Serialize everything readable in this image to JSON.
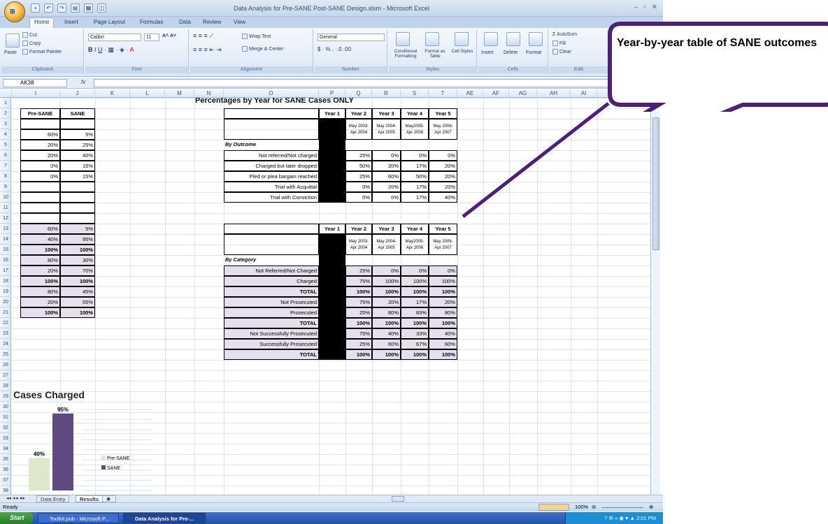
{
  "window": {
    "title": "Data Analysis for Pre-SANE Post-SANE Design.xlsm - Microsoft Excel",
    "office_button": "Office",
    "controls": [
      "–",
      "▫",
      "✕"
    ]
  },
  "ribbon": {
    "tabs": [
      "Home",
      "Insert",
      "Page Layout",
      "Formulas",
      "Data",
      "Review",
      "View"
    ],
    "clipboard": {
      "paste": "Paste",
      "cut": "Cut",
      "copy": "Copy",
      "format_painter": "Format Painter",
      "label": "Clipboard"
    },
    "font": {
      "name": "Calibri",
      "size": "11",
      "label": "Font"
    },
    "alignment": {
      "wrap": "Wrap Text",
      "merge": "Merge & Center",
      "label": "Alignment"
    },
    "number": {
      "format": "General",
      "label": "Number"
    },
    "styles": {
      "conditional": "Conditional Formatting",
      "table": "Format as Table",
      "cell": "Cell Styles",
      "label": "Styles"
    },
    "cells": {
      "insert": "Insert",
      "delete": "Delete",
      "format": "Format",
      "label": "Cells"
    },
    "editing": {
      "autosum": "AutoSum",
      "fill": "Fill",
      "clear": "Clear",
      "label": "Editi"
    }
  },
  "formula_bar": {
    "name_box": "AK38",
    "fx": "fx",
    "value": ""
  },
  "columns": [
    "I",
    "J",
    "K",
    "L",
    "M",
    "N",
    "O",
    "P",
    "Q",
    "R",
    "S",
    "T",
    "AE",
    "AF",
    "AG",
    "AH",
    "AI"
  ],
  "rows": [
    "1",
    "2",
    "3",
    "4",
    "5",
    "6",
    "7",
    "8",
    "9",
    "10",
    "11",
    "12",
    "13",
    "14",
    "15",
    "16",
    "17",
    "18",
    "19",
    "20",
    "21",
    "22",
    "23",
    "24",
    "25",
    "26",
    "27",
    "28",
    "29",
    "30",
    "31",
    "32",
    "33",
    "34",
    "35",
    "36",
    "37",
    "38"
  ],
  "left_table": {
    "headers": [
      "Pre-SANE",
      "SANE"
    ],
    "rows": [
      [
        "",
        ""
      ],
      [
        "60%",
        "5%"
      ],
      [
        "20%",
        "25%"
      ],
      [
        "20%",
        "40%"
      ],
      [
        "0%",
        "15%"
      ],
      [
        "0%",
        "15%"
      ],
      [
        "",
        ""
      ],
      [
        "",
        ""
      ],
      [
        "",
        ""
      ],
      [
        "",
        ""
      ],
      [
        "60%",
        "5%"
      ],
      [
        "40%",
        "95%"
      ],
      [
        "100%",
        "100%"
      ],
      [
        "80%",
        "30%"
      ],
      [
        "20%",
        "70%"
      ],
      [
        "100%",
        "100%"
      ],
      [
        "80%",
        "45%"
      ],
      [
        "20%",
        "55%"
      ],
      [
        "100%",
        "100%"
      ]
    ]
  },
  "sheet_title": "Percentages by Year for SANE Cases ONLY",
  "outcome_table": {
    "years": [
      "Year 1",
      "Year 2",
      "Year 3",
      "Year 4",
      "Year 5"
    ],
    "periods": [
      "May 2003-Apr 2004",
      "May 2004-Apr 2005",
      "May2005-Apr 2006",
      "May 2006-Apr 2007"
    ],
    "section": "By Outcome",
    "rows": [
      {
        "label": "Not referred/Not charged",
        "values": [
          "25%",
          "0%",
          "0%",
          "0%"
        ]
      },
      {
        "label": "Charged but later dropped",
        "values": [
          "50%",
          "20%",
          "17%",
          "20%"
        ]
      },
      {
        "label": "Pled or plea bargain reached",
        "values": [
          "25%",
          "60%",
          "50%",
          "20%"
        ]
      },
      {
        "label": "Trial with Acquittal",
        "values": [
          "0%",
          "20%",
          "17%",
          "20%"
        ]
      },
      {
        "label": "Trial with Conviction",
        "values": [
          "0%",
          "0%",
          "17%",
          "40%"
        ]
      }
    ]
  },
  "category_table": {
    "years": [
      "Year 1",
      "Year 2",
      "Year 3",
      "Year 4",
      "Year 5"
    ],
    "periods": [
      "May 2003-Apr 2004",
      "May 2004-Apr 2005",
      "May2005-Apr 2006",
      "May 2006-Apr 2007"
    ],
    "section": "By Category",
    "rows": [
      {
        "label": "Not Referred/Not Charged",
        "values": [
          "25%",
          "0%",
          "0%",
          "0%"
        ],
        "bold": false
      },
      {
        "label": "Charged",
        "values": [
          "75%",
          "100%",
          "100%",
          "100%"
        ],
        "bold": false
      },
      {
        "label": "TOTAL",
        "values": [
          "100%",
          "100%",
          "100%",
          "100%"
        ],
        "bold": true
      },
      {
        "label": "Not Prosecuted",
        "values": [
          "75%",
          "20%",
          "17%",
          "20%"
        ],
        "bold": false
      },
      {
        "label": "Prosecuted",
        "values": [
          "25%",
          "80%",
          "83%",
          "80%"
        ],
        "bold": false
      },
      {
        "label": "TOTAL",
        "values": [
          "100%",
          "100%",
          "100%",
          "100%"
        ],
        "bold": true
      },
      {
        "label": "Not Successfully Prosecuted",
        "values": [
          "75%",
          "40%",
          "33%",
          "40%"
        ],
        "bold": false
      },
      {
        "label": "Successfully Prosecuted",
        "values": [
          "25%",
          "60%",
          "67%",
          "60%"
        ],
        "bold": false
      },
      {
        "label": "TOTAL",
        "values": [
          "100%",
          "100%",
          "100%",
          "100%"
        ],
        "bold": true
      }
    ]
  },
  "chart_data": {
    "type": "bar",
    "title": "Cases Charged",
    "categories": [
      "Pre-SANE",
      "SANE"
    ],
    "series": [
      {
        "name": "Pre-SANE",
        "values": [
          40
        ],
        "color": "#dde8c8"
      },
      {
        "name": "SANE",
        "values": [
          95
        ],
        "color": "#5e4a80"
      }
    ],
    "data_labels": [
      "40%",
      "95%"
    ],
    "ylim": [
      0,
      100
    ],
    "legend": "right"
  },
  "sheet_tabs": [
    "Data Entry",
    "Results"
  ],
  "status": {
    "ready": "Ready",
    "zoom": "100%"
  },
  "taskbar": {
    "start": "Start",
    "buttons": [
      "Toolkit.pub - Microsoft P...",
      "Data Analysis for Pre-..."
    ],
    "clock": "2:01 PM"
  },
  "callout": {
    "text": "Year-by-year table of SANE outcomes",
    "color": "#4b1f7a"
  }
}
